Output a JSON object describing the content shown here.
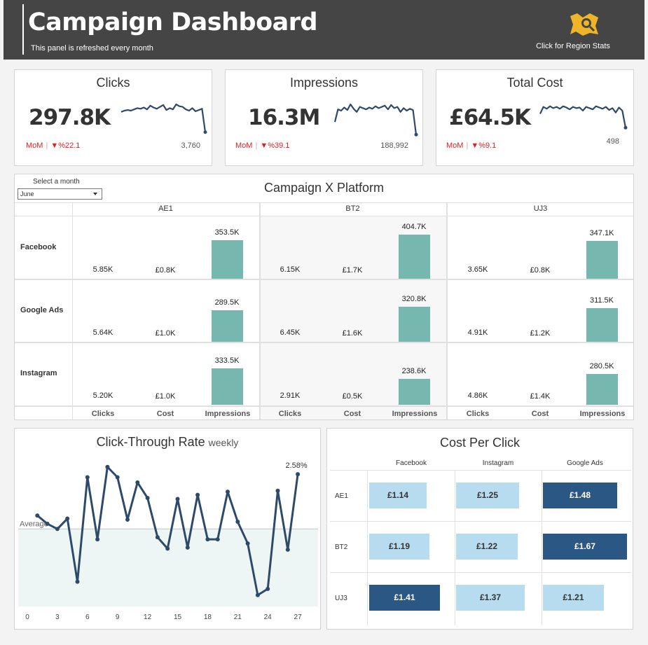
{
  "header": {
    "title": "Campaign Dashboard",
    "subtitle": "This panel is refreshed every month",
    "region_button_label": "Click for Region Stats"
  },
  "kpis": {
    "clicks": {
      "title": "Clicks",
      "value": "297.8K",
      "mom_label": "MoM",
      "mom_change": "▼%22.1",
      "last_value": "3,760",
      "spark": [
        58,
        60,
        61,
        60,
        62,
        64,
        63,
        65,
        62,
        68,
        65,
        63,
        66,
        69,
        61,
        64,
        62,
        70,
        67,
        66,
        62,
        60,
        64,
        59,
        61,
        63,
        26
      ]
    },
    "impressions": {
      "title": "Impressions",
      "value": "16.3M",
      "mom_label": "MoM",
      "mom_change": "▼%39.1",
      "last_value": "188,992",
      "spark": [
        42,
        62,
        60,
        65,
        61,
        70,
        63,
        58,
        66,
        64,
        62,
        65,
        63,
        67,
        64,
        66,
        68,
        62,
        69,
        64,
        66,
        58,
        64,
        60,
        63,
        61,
        22
      ]
    },
    "total_cost": {
      "title": "Total Cost",
      "value": "£64.5K",
      "mom_label": "MoM",
      "mom_change": "▼%9.1",
      "last_value": "498",
      "spark": [
        55,
        66,
        63,
        67,
        64,
        66,
        63,
        67,
        65,
        62,
        66,
        64,
        65,
        60,
        66,
        64,
        62,
        67,
        65,
        63,
        66,
        61,
        64,
        57,
        65,
        60,
        33
      ]
    }
  },
  "matrix": {
    "title": "Campaign X Platform",
    "month_label": "Select a month",
    "month_value": "June",
    "columns": [
      "AE1",
      "BT2",
      "UJ3"
    ],
    "rows": [
      "Facebook",
      "Google Ads",
      "Instagram"
    ],
    "measure_labels": [
      "Clicks",
      "Cost",
      "Impressions"
    ],
    "cells": [
      [
        {
          "clicks": "5.85K",
          "cost": "£0.8K",
          "impressions": "353.5K",
          "imp_value": 353.5
        },
        {
          "clicks": "6.15K",
          "cost": "£1.7K",
          "impressions": "404.7K",
          "imp_value": 404.7
        },
        {
          "clicks": "3.65K",
          "cost": "£0.8K",
          "impressions": "347.1K",
          "imp_value": 347.1
        }
      ],
      [
        {
          "clicks": "5.64K",
          "cost": "£1.0K",
          "impressions": "289.5K",
          "imp_value": 289.5
        },
        {
          "clicks": "6.45K",
          "cost": "£1.6K",
          "impressions": "320.8K",
          "imp_value": 320.8
        },
        {
          "clicks": "4.91K",
          "cost": "£1.2K",
          "impressions": "311.5K",
          "imp_value": 311.5
        }
      ],
      [
        {
          "clicks": "5.20K",
          "cost": "£1.0K",
          "impressions": "333.5K",
          "imp_value": 333.5
        },
        {
          "clicks": "2.91K",
          "cost": "£0.5K",
          "impressions": "238.6K",
          "imp_value": 238.6
        },
        {
          "clicks": "4.86K",
          "cost": "£1.4K",
          "impressions": "280.5K",
          "imp_value": 280.5
        }
      ]
    ]
  },
  "chart_data": {
    "type": "line",
    "title": "Click-Through Rate",
    "subtitle": "weekly",
    "x": [
      1,
      2,
      3,
      4,
      5,
      6,
      7,
      8,
      9,
      10,
      11,
      12,
      13,
      14,
      15,
      16,
      17,
      18,
      19,
      20,
      21,
      22,
      23,
      24,
      25,
      26,
      27
    ],
    "values": [
      2.18,
      2.1,
      2.05,
      2.15,
      1.54,
      2.55,
      1.95,
      2.65,
      2.55,
      2.14,
      2.5,
      2.35,
      1.97,
      1.86,
      2.34,
      1.87,
      2.38,
      1.95,
      1.95,
      2.41,
      2.12,
      1.91,
      1.41,
      1.47,
      2.42,
      1.85,
      2.58
    ],
    "average": 2.05,
    "average_label": "Average",
    "last_label": "2.58%",
    "xticks": [
      0,
      3,
      6,
      9,
      12,
      15,
      18,
      21,
      24,
      27
    ],
    "xlim": [
      0,
      28
    ],
    "ylim": [
      1.3,
      2.75
    ]
  },
  "cpc": {
    "title": "Cost Per Click",
    "columns": [
      "Facebook",
      "Instagram",
      "Google Ads"
    ],
    "rows": [
      "AE1",
      "BT2",
      "UJ3"
    ],
    "values": [
      [
        {
          "label": "£1.14",
          "v": 1.14
        },
        {
          "label": "£1.25",
          "v": 1.25
        },
        {
          "label": "£1.48",
          "v": 1.48
        }
      ],
      [
        {
          "label": "£1.19",
          "v": 1.19
        },
        {
          "label": "£1.22",
          "v": 1.22
        },
        {
          "label": "£1.67",
          "v": 1.67
        }
      ],
      [
        {
          "label": "£1.41",
          "v": 1.41
        },
        {
          "label": "£1.37",
          "v": 1.37
        },
        {
          "label": "£1.21",
          "v": 1.21
        }
      ]
    ],
    "colors": {
      "light": "#b7dcef",
      "dark": "#2a5783"
    }
  },
  "colors": {
    "header_bg": "#454545",
    "spark_line": "#2e4a6b",
    "bar": "#76b7b0",
    "negative": "#e01f1f"
  }
}
